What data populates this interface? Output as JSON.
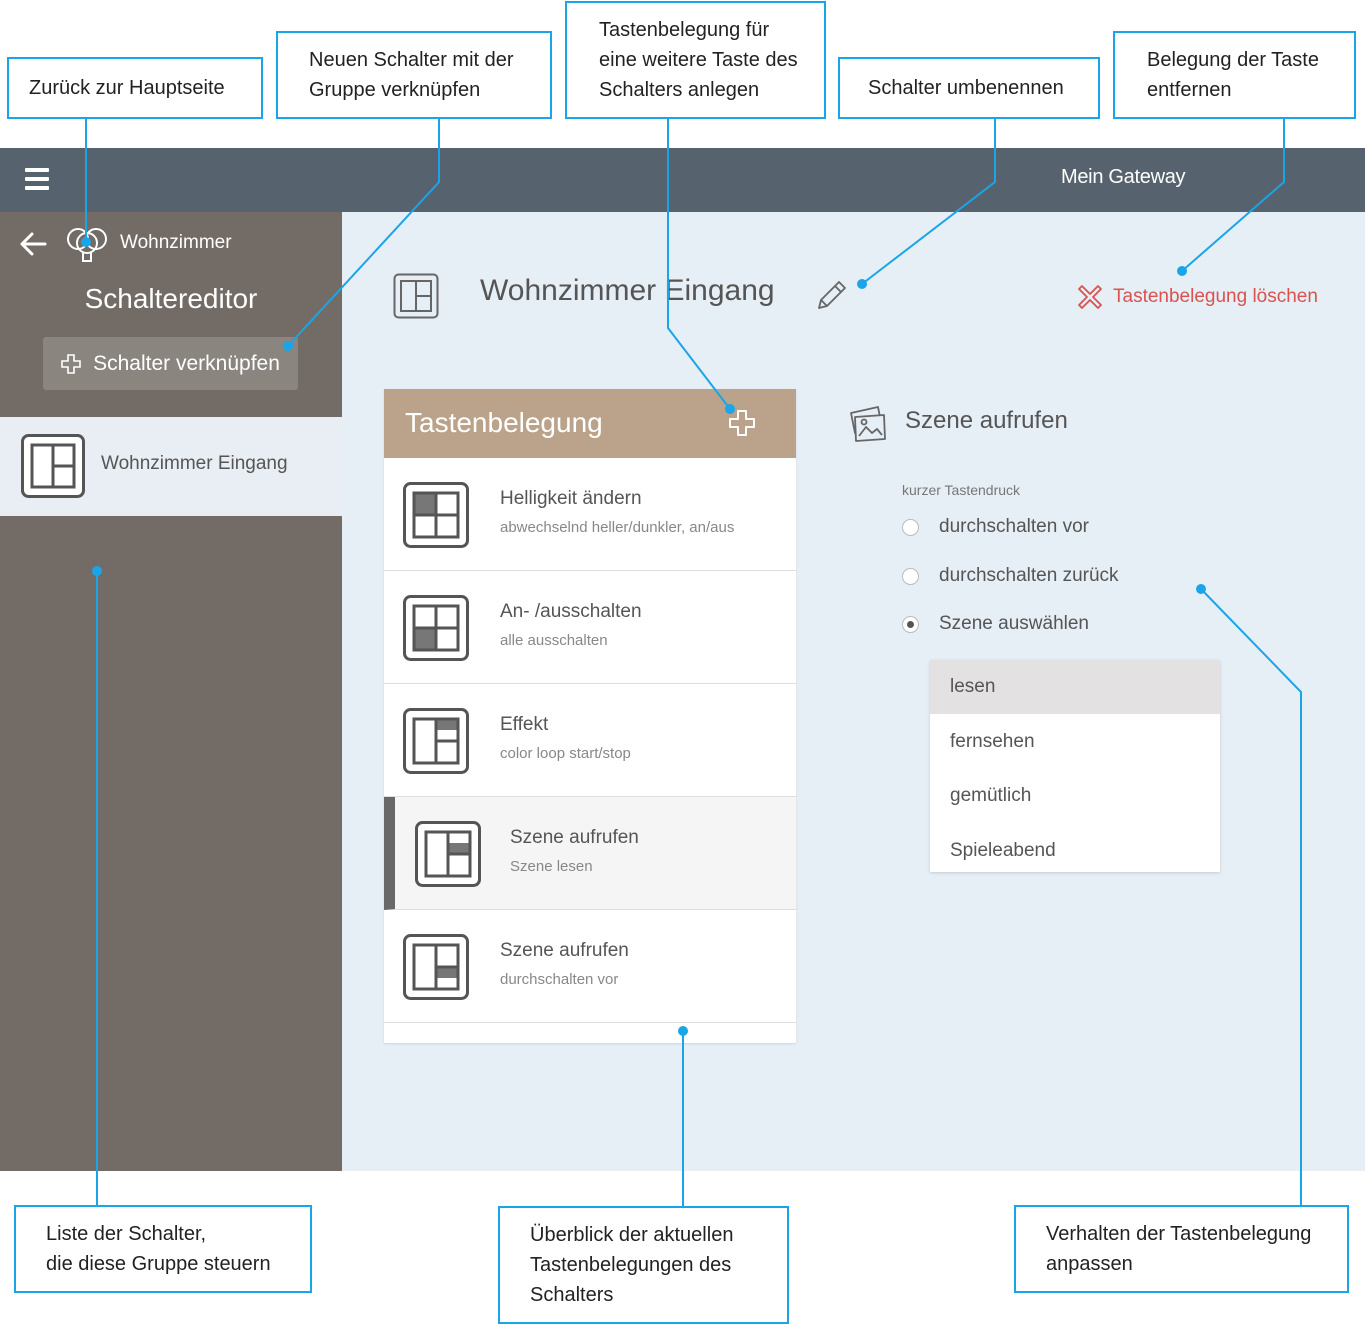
{
  "callouts": {
    "back": "Zurück zur Hauptseite",
    "link_switch": "Neuen Schalter mit der\nGruppe verknüpfen",
    "add_key": "Tastenbelegung für\neine weitere Taste des\nSchalters anlegen",
    "rename": "Schalter umbenennen",
    "remove_key": "Belegung der Taste\nentfernen",
    "switch_list": "Liste der Schalter,\ndie diese Gruppe steuern",
    "overview": "Überblick der aktuellen\nTastenbelegungen des\nSchalters",
    "behavior": "Verhalten der Tastenbelegung\nanpassen"
  },
  "topbar": {
    "gateway": "Mein Gateway"
  },
  "sidebar": {
    "breadcrumb": "Wohnzimmer",
    "title": "Schaltereditor",
    "link_button": "Schalter verknüpfen",
    "switches": [
      {
        "label": "Wohnzimmer Eingang"
      }
    ]
  },
  "main": {
    "title": "Wohnzimmer Eingang",
    "delete_label": "Tastenbelegung löschen",
    "panel_title": "Tastenbelegung",
    "rows": [
      {
        "title": "Helligkeit ändern",
        "subtitle": "abwechselnd heller/dunkler, an/aus"
      },
      {
        "title": "An- /ausschalten",
        "subtitle": "alle ausschalten"
      },
      {
        "title": "Effekt",
        "subtitle": "color loop start/stop"
      },
      {
        "title": "Szene aufrufen",
        "subtitle": "Szene lesen"
      },
      {
        "title": "Szene aufrufen",
        "subtitle": "durchschalten vor"
      }
    ]
  },
  "detail": {
    "title": "Szene aufrufen",
    "press_label": "kurzer Tastendruck",
    "options": [
      "durchschalten vor",
      "durchschalten zurück",
      "Szene auswählen"
    ],
    "selected_option": 2,
    "scenes": [
      "lesen",
      "fernsehen",
      "gemütlich",
      "Spieleabend"
    ],
    "selected_scene": 0
  },
  "colors": {
    "topbar": "#56626d",
    "sidebar": "#726b66",
    "main_bg": "#e6eef6",
    "panel_header": "#baa38a",
    "delete": "#d9534f",
    "callout_border": "#1aa5e8"
  }
}
